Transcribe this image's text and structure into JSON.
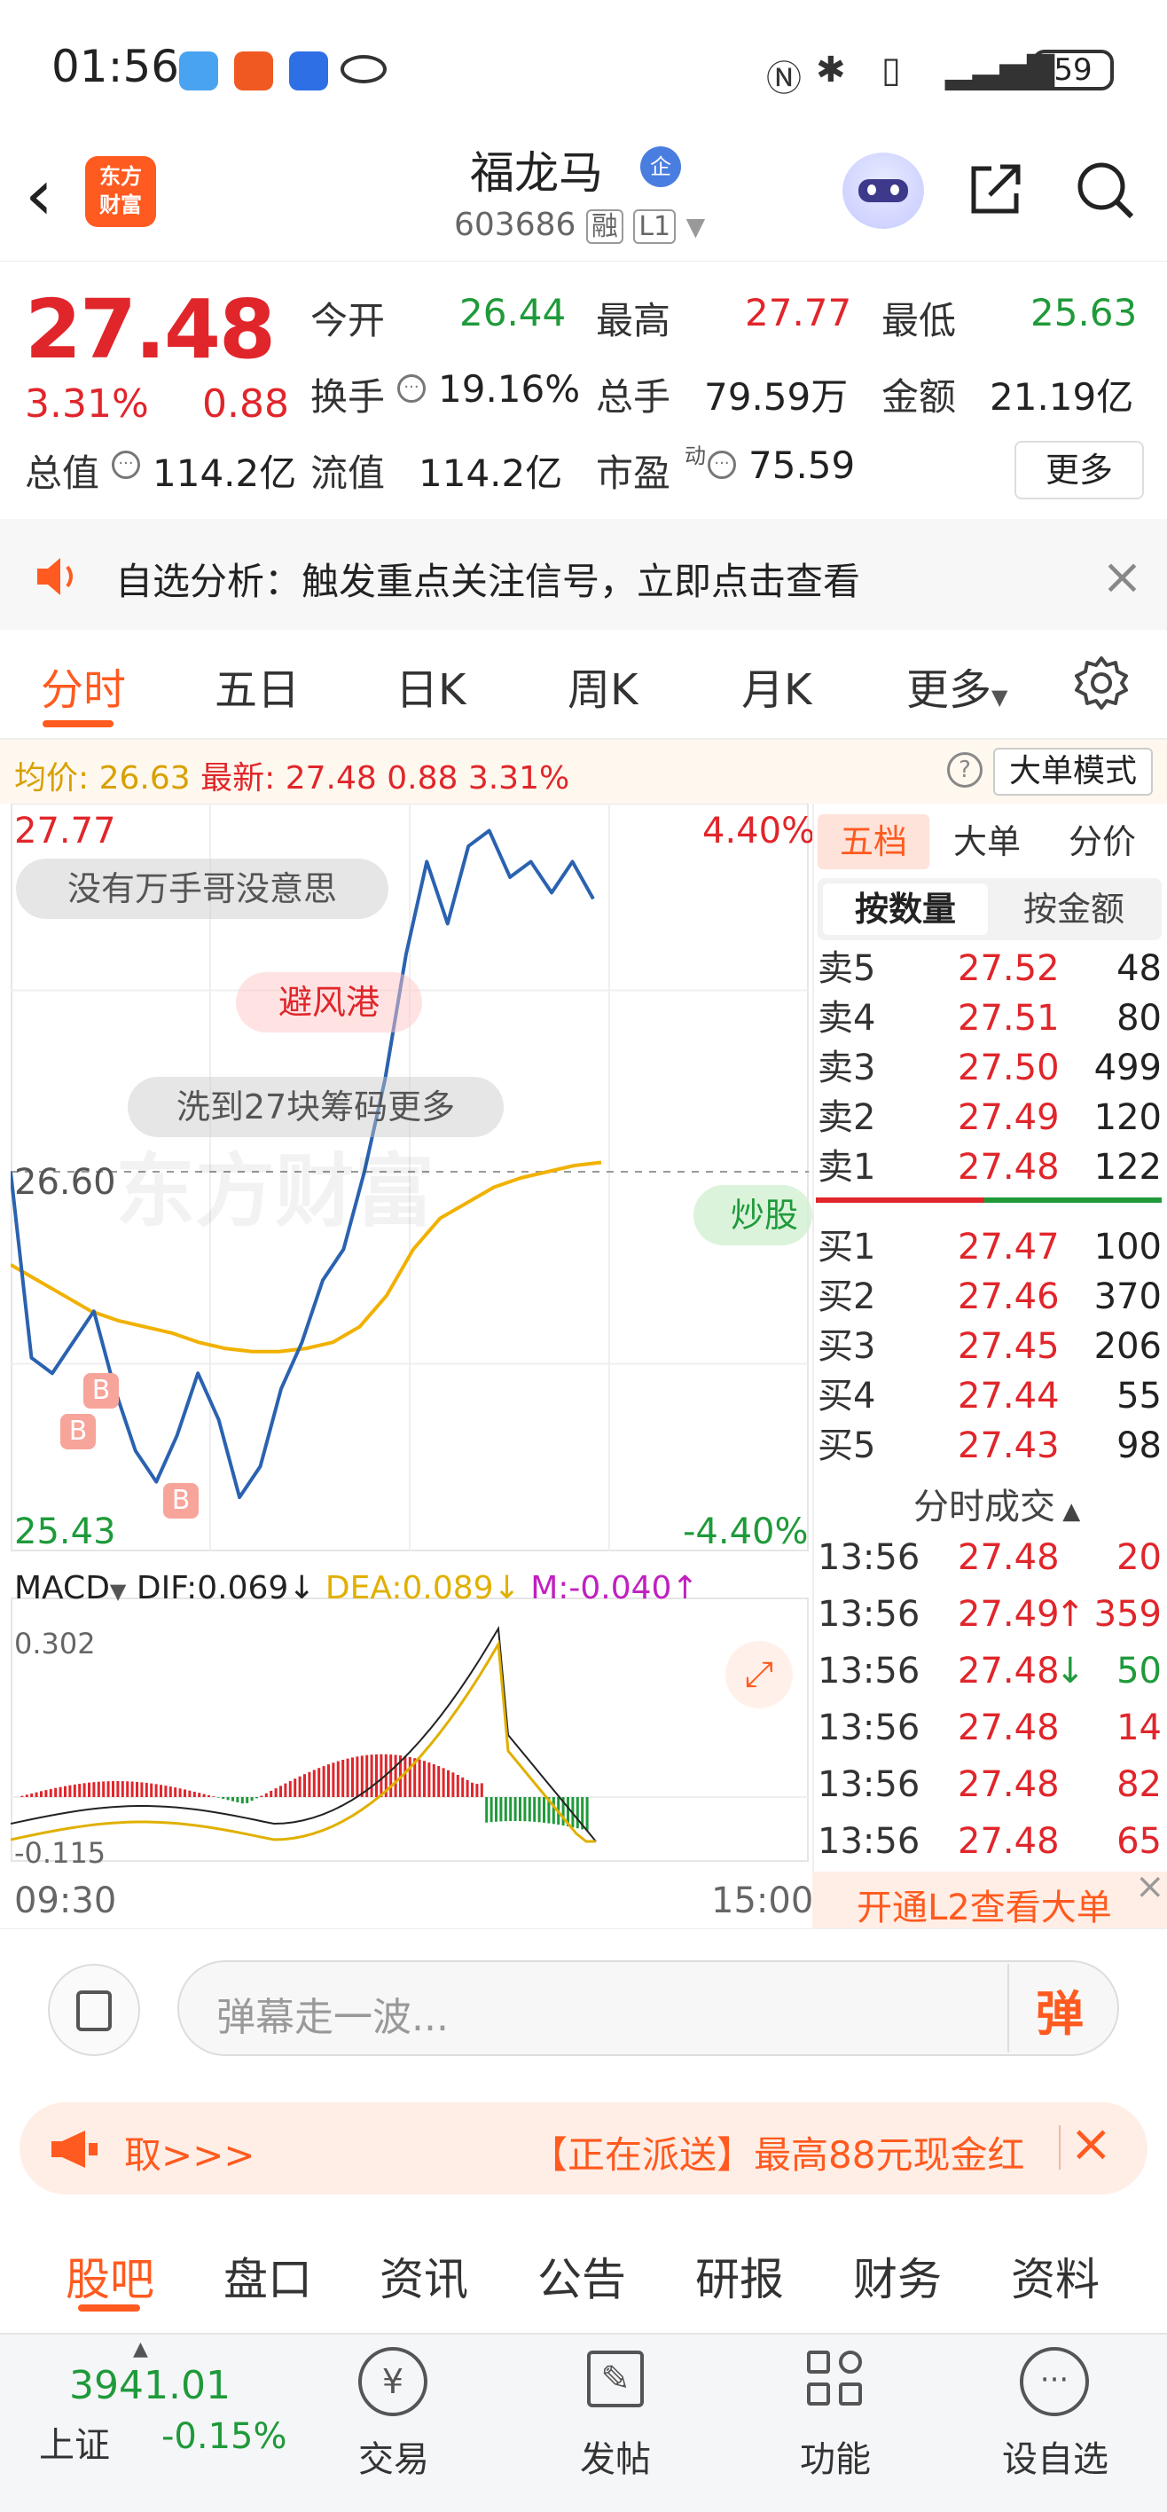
{
  "status_bar": {
    "time": "01:56",
    "battery": "59"
  },
  "header": {
    "logo_text_1": "东方",
    "logo_text_2": "财富",
    "stock_name": "福龙马",
    "badge": "企",
    "stock_code": "603686",
    "code_tag_1": "融",
    "code_tag_2": "L1"
  },
  "quote": {
    "price": "27.48",
    "pct": "3.31%",
    "change": "0.88",
    "open_label": "今开",
    "open": "26.44",
    "high_label": "最高",
    "high": "27.77",
    "low_label": "最低",
    "low": "25.63",
    "turnover_label": "换手",
    "turnover": "19.16%",
    "volume_label": "总手",
    "volume": "79.59万",
    "amount_label": "金额",
    "amount": "21.19亿",
    "mktcap_label": "总值",
    "mktcap": "114.2亿",
    "float_label": "流值",
    "float": "114.2亿",
    "pe_label": "市盈",
    "pe_sup": "动",
    "pe": "75.59",
    "more": "更多"
  },
  "notice": {
    "text": "自选分析：触发重点关注信号，立即点击查看"
  },
  "tabs": [
    "分时",
    "五日",
    "日K",
    "周K",
    "月K",
    "更多"
  ],
  "legend": {
    "avg_label": "均价:",
    "avg": "26.63",
    "latest_label": "最新:",
    "latest": "27.48",
    "latest_chg": "0.88",
    "latest_pct": "3.31%",
    "big_mode": "大单模式"
  },
  "chart": {
    "y_top": "27.77",
    "y_mid": "26.60",
    "y_bottom": "25.43",
    "pct_top": "4.40%",
    "pct_bottom": "-4.40%",
    "x_start": "09:30",
    "x_end": "15:00",
    "bubble_1": "没有万手哥没意思",
    "bubble_2": "避风港",
    "bubble_3": "洗到27块筹码更多",
    "bubble_4": "炒股",
    "watermark": "东方财富",
    "buy_marker": "B",
    "macd_label": "MACD",
    "dif": "DIF:0.069↓",
    "dea": "DEA:0.089↓",
    "m": "M:-0.040↑",
    "macd_top": "0.302",
    "macd_bottom": "-0.115"
  },
  "chart_data": {
    "type": "line",
    "title": "",
    "x_range": [
      "09:30",
      "15:00"
    ],
    "ylim": [
      25.43,
      27.77
    ],
    "reference_price": 26.6,
    "series": [
      {
        "name": "",
        "color": "#2a62b0",
        "values": [
          26.6,
          26.0,
          25.95,
          26.05,
          26.15,
          25.9,
          25.7,
          25.6,
          25.75,
          25.95,
          25.8,
          25.55,
          25.65,
          25.9,
          26.05,
          26.25,
          26.35,
          26.6,
          26.9,
          27.3,
          27.6,
          27.4,
          27.65,
          27.7,
          27.55,
          27.6,
          27.5,
          27.6,
          27.48
        ]
      },
      {
        "name": "",
        "color": "#f1b100",
        "values": [
          26.3,
          26.25,
          26.2,
          26.15,
          26.12,
          26.1,
          26.08,
          26.05,
          26.03,
          26.02,
          26.02,
          26.03,
          26.05,
          26.1,
          26.2,
          26.35,
          26.45,
          26.5,
          26.55,
          26.58,
          26.6,
          26.62,
          26.63
        ]
      }
    ]
  },
  "orderbook": {
    "tabs": [
      "五档",
      "大单",
      "分价"
    ],
    "subtabs": [
      "按数量",
      "按金额"
    ],
    "sells": [
      {
        "label": "卖5",
        "price": "27.52",
        "vol": "48"
      },
      {
        "label": "卖4",
        "price": "27.51",
        "vol": "80"
      },
      {
        "label": "卖3",
        "price": "27.50",
        "vol": "499"
      },
      {
        "label": "卖2",
        "price": "27.49",
        "vol": "120"
      },
      {
        "label": "卖1",
        "price": "27.48",
        "vol": "122"
      }
    ],
    "buys": [
      {
        "label": "买1",
        "price": "27.47",
        "vol": "100"
      },
      {
        "label": "买2",
        "price": "27.46",
        "vol": "370"
      },
      {
        "label": "买3",
        "price": "27.45",
        "vol": "206"
      },
      {
        "label": "买4",
        "price": "27.44",
        "vol": "55"
      },
      {
        "label": "买5",
        "price": "27.43",
        "vol": "98"
      }
    ],
    "ticks_title": "分时成交",
    "ticks": [
      {
        "time": "13:56",
        "price": "27.48",
        "vol": "20",
        "arrow": ""
      },
      {
        "time": "13:56",
        "price": "27.49",
        "vol": "359",
        "arrow": "↑"
      },
      {
        "time": "13:56",
        "price": "27.48",
        "vol": "50",
        "arrow": "↓"
      },
      {
        "time": "13:56",
        "price": "27.48",
        "vol": "14",
        "arrow": ""
      },
      {
        "time": "13:56",
        "price": "27.48",
        "vol": "82",
        "arrow": ""
      },
      {
        "time": "13:56",
        "price": "27.48",
        "vol": "65",
        "arrow": ""
      }
    ],
    "l2_promo": "开通L2查看大单"
  },
  "danmu": {
    "placeholder": "弹幕走一波...",
    "send": "弹"
  },
  "promo": {
    "left": "取>>>",
    "right": "【正在派送】最高88元现金红"
  },
  "bottom_tabs": [
    "股吧",
    "盘口",
    "资讯",
    "公告",
    "研报",
    "财务",
    "资料"
  ],
  "nav": {
    "index_value": "3941.01",
    "index_name": "上证",
    "index_pct": "-0.15%",
    "items": [
      "交易",
      "发帖",
      "功能",
      "设自选"
    ]
  },
  "colors": {
    "up": "#e0262b",
    "down": "#1f9a3a",
    "accent": "#ff5a1f",
    "price_line": "#2a62b0",
    "avg_line": "#f1b100"
  }
}
